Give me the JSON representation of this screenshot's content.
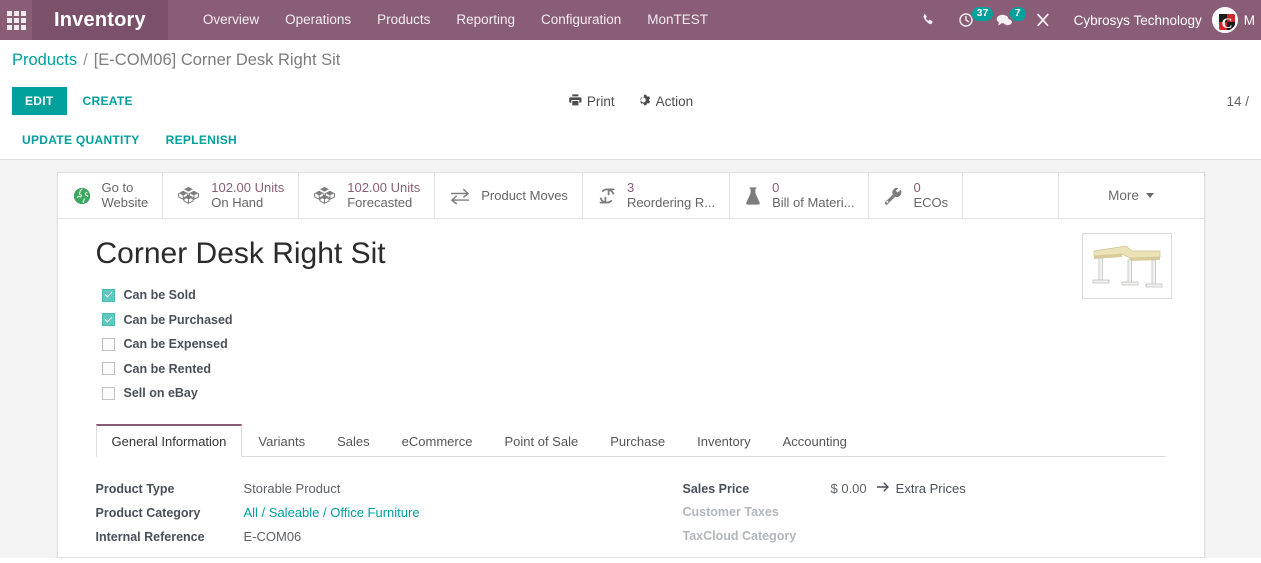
{
  "navbar": {
    "apps_icon": "apps-grid-icon",
    "brand": "Inventory",
    "menus": [
      {
        "label": "Overview"
      },
      {
        "label": "Operations"
      },
      {
        "label": "Products"
      },
      {
        "label": "Reporting"
      },
      {
        "label": "Configuration"
      },
      {
        "label": "MonTEST"
      }
    ],
    "icons": [
      {
        "name": "phone-icon",
        "badge": null
      },
      {
        "name": "activity-clock-icon",
        "badge": "37"
      },
      {
        "name": "messages-icon",
        "badge": "7"
      },
      {
        "name": "developer-tools-icon",
        "badge": null
      }
    ],
    "company": "Cybrosys Technology",
    "avatar_icon": "user-avatar",
    "user_initial": "M",
    "bg_color": "#8a5d77",
    "brand_bg_color": "#7b5169"
  },
  "breadcrumb": {
    "parent": "Products",
    "separator": "/",
    "current": "[E-COM06] Corner Desk Right Sit"
  },
  "control_panel": {
    "edit_label": "EDIT",
    "create_label": "CREATE",
    "print_label": "Print",
    "print_icon": "printer-icon",
    "action_label": "Action",
    "action_icon": "gear-icon",
    "pager": "14 /",
    "accent_color": "#00a09d"
  },
  "sub_toolbar": {
    "buttons": [
      {
        "label": "UPDATE QUANTITY"
      },
      {
        "label": "REPLENISH"
      }
    ]
  },
  "stat_buttons": [
    {
      "icon": "globe-icon",
      "value": null,
      "line1": "Go to",
      "line2": "Website",
      "two_line": true
    },
    {
      "icon": "boxes-icon",
      "value": "102.00 Units",
      "label": "On Hand",
      "two_line": false
    },
    {
      "icon": "boxes-icon",
      "value": "102.00 Units",
      "label": "Forecasted",
      "two_line": false
    },
    {
      "icon": "exchange-arrows-icon",
      "value": null,
      "label": "Product Moves",
      "two_line": false
    },
    {
      "icon": "refresh-icon",
      "value": "3",
      "label": "Reordering R...",
      "two_line": false
    },
    {
      "icon": "flask-icon",
      "value": "0",
      "label": "Bill of Materi...",
      "two_line": false
    },
    {
      "icon": "wrench-icon",
      "value": "0",
      "label": "ECOs",
      "two_line": false
    }
  ],
  "stat_more": {
    "label": "More",
    "icon": "chevron-down-icon"
  },
  "product": {
    "title": "Corner Desk Right Sit",
    "image_alt": "corner-desk-thumbnail",
    "checkboxes": [
      {
        "label": "Can be Sold",
        "checked": true
      },
      {
        "label": "Can be Purchased",
        "checked": true
      },
      {
        "label": "Can be Expensed",
        "checked": false
      },
      {
        "label": "Can be Rented",
        "checked": false
      },
      {
        "label": "Sell on eBay",
        "checked": false
      }
    ]
  },
  "notebook": {
    "tabs": [
      {
        "label": "General Information",
        "active": true
      },
      {
        "label": "Variants",
        "active": false
      },
      {
        "label": "Sales",
        "active": false
      },
      {
        "label": "eCommerce",
        "active": false
      },
      {
        "label": "Point of Sale",
        "active": false
      },
      {
        "label": "Purchase",
        "active": false
      },
      {
        "label": "Inventory",
        "active": false
      },
      {
        "label": "Accounting",
        "active": false
      }
    ],
    "left_fields": [
      {
        "label": "Product Type",
        "value": "Storable Product",
        "kind": "text"
      },
      {
        "label": "Product Category",
        "value": "All / Saleable / Office Furniture",
        "kind": "link"
      },
      {
        "label": "Internal Reference",
        "value": "E-COM06",
        "kind": "text"
      }
    ],
    "right_fields": [
      {
        "label": "Sales Price",
        "value": "$ 0.00",
        "kind": "price",
        "extra_label": "Extra Prices",
        "extra_icon": "arrow-right-icon",
        "muted": false
      },
      {
        "label": "Customer Taxes",
        "value": "",
        "kind": "text",
        "muted": true
      },
      {
        "label": "TaxCloud Category",
        "value": "",
        "kind": "text",
        "muted": true
      }
    ]
  }
}
